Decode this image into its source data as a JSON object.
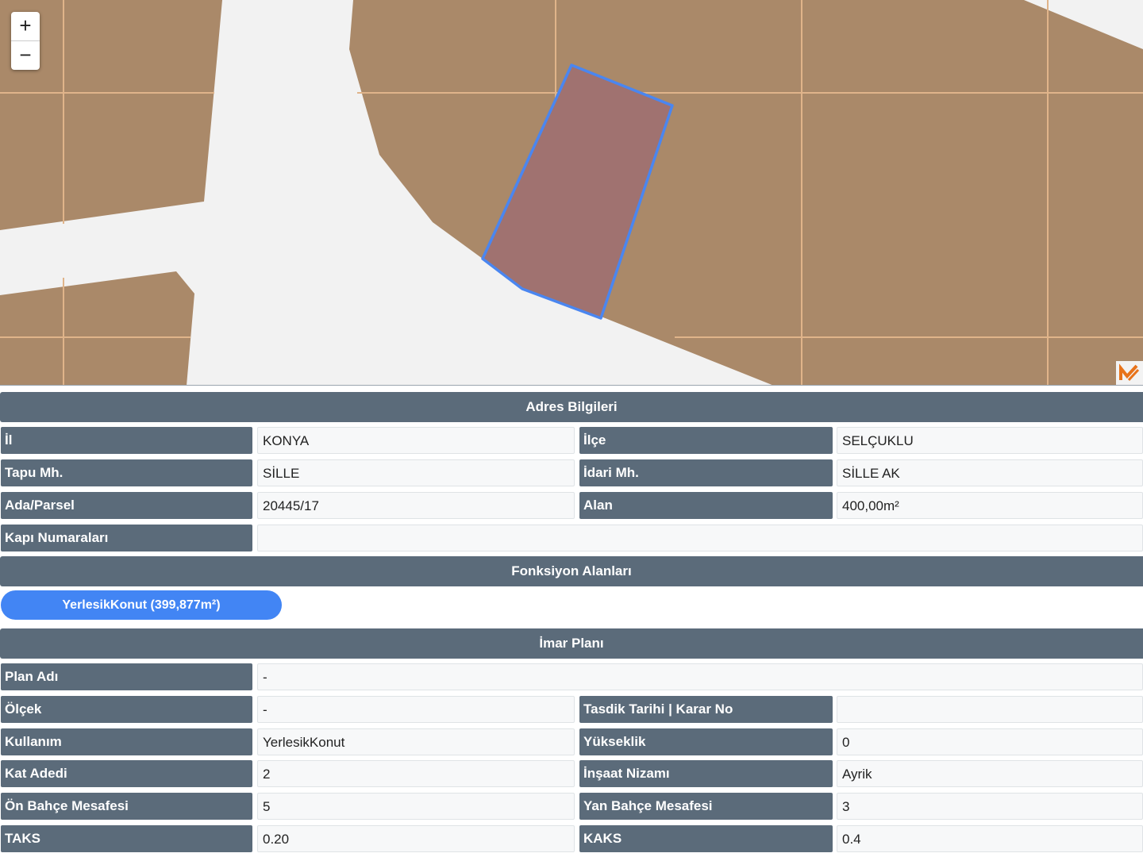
{
  "map": {
    "zoom_in_label": "+",
    "zoom_out_label": "−",
    "colors": {
      "background": "#f2f2f2",
      "parcel_fill": "#aa8969",
      "grid_line": "#e0b48a",
      "selected_fill": "#a07270",
      "selected_stroke": "#4a86f0"
    }
  },
  "address": {
    "header": "Adres Bilgileri",
    "il_label": "İl",
    "il_value": "KONYA",
    "ilce_label": "İlçe",
    "ilce_value": "SELÇUKLU",
    "tapu_label": "Tapu Mh.",
    "tapu_value": "SİLLE",
    "idari_label": "İdari Mh.",
    "idari_value": "SİLLE AK",
    "ada_label": "Ada/Parsel",
    "ada_value": "20445/17",
    "alan_label": "Alan",
    "alan_value": "400,00m²",
    "kapi_label": "Kapı Numaraları",
    "kapi_value": ""
  },
  "functions": {
    "header": "Fonksiyon Alanları",
    "items": [
      "YerlesikKonut (399,877m²)"
    ]
  },
  "imar": {
    "header": "İmar Planı",
    "plan_adi_label": "Plan Adı",
    "plan_adi_value": "-",
    "olcek_label": "Ölçek",
    "olcek_value": "-",
    "tasdik_label": "Tasdik Tarihi | Karar No",
    "tasdik_value": "",
    "kullanim_label": "Kullanım",
    "kullanim_value": "YerlesikKonut",
    "yukseklik_label": "Yükseklik",
    "yukseklik_value": "0",
    "kat_label": "Kat Adedi",
    "kat_value": "2",
    "insaat_label": "İnşaat Nizamı",
    "insaat_value": "Ayrik",
    "on_bahce_label": "Ön Bahçe Mesafesi",
    "on_bahce_value": "5",
    "yan_bahce_label": "Yan Bahçe Mesafesi",
    "yan_bahce_value": "3",
    "taks_label": "TAKS",
    "taks_value": "0.20",
    "kaks_label": "KAKS",
    "kaks_value": "0.4"
  }
}
